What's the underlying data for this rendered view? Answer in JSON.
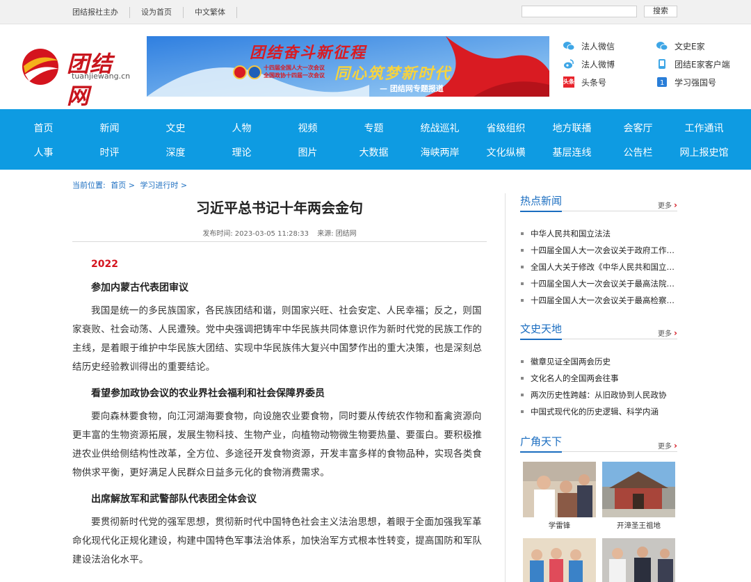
{
  "topbar": {
    "links": [
      "团结报社主办",
      "设为首页",
      "中文繁体"
    ],
    "search_placeholder": "",
    "search_button": "搜索"
  },
  "header": {
    "logo_text": "团结网",
    "logo_domain": "tuanjiewang.cn",
    "banner": {
      "title": "团结奋斗新征程",
      "subtitle": "同心筑梦新时代",
      "line1": "十四届全国人大一次会议",
      "line2": "全国政协十四届一次会议",
      "tag": "— 团结网专题报道"
    },
    "social_left": [
      "法人微信",
      "法人微博",
      "头条号"
    ],
    "social_right": [
      "文史E家",
      "团结E家客户端",
      "学习强国号"
    ],
    "toutiao_badge": "头条"
  },
  "nav": {
    "row1": [
      "首页",
      "新闻",
      "文史",
      "人物",
      "视频",
      "专题",
      "统战巡礼",
      "省级组织",
      "地方联播",
      "会客厅",
      "工作通讯"
    ],
    "row2": [
      "人事",
      "时评",
      "深度",
      "理论",
      "图片",
      "大数据",
      "海峡两岸",
      "文化纵横",
      "基层连线",
      "公告栏",
      "网上报史馆"
    ]
  },
  "breadcrumb": {
    "label": "当前位置:",
    "items": [
      "首页 >",
      "学习进行时 >"
    ]
  },
  "article": {
    "title": "习近平总书记十年两会金句",
    "meta_time_label": "发布时间:",
    "meta_time": "2023-03-05 11:28:33",
    "meta_source_label": "来源:",
    "meta_source": "团结网",
    "year": "2022",
    "sections": [
      {
        "heading": "参加内蒙古代表团审议",
        "body": "我国是统一的多民族国家，各民族团结和谐，则国家兴旺、社会安定、人民幸福；反之，则国家衰败、社会动荡、人民遭殃。党中央强调把铸牢中华民族共同体意识作为新时代党的民族工作的主线，是着眼于维护中华民族大团结、实现中华民族伟大复兴中国梦作出的重大决策，也是深刻总结历史经验教训得出的重要结论。"
      },
      {
        "heading": "看望参加政协会议的农业界社会福利和社会保障界委员",
        "body": "要向森林要食物，向江河湖海要食物，向设施农业要食物，同时要从传统农作物和畜禽资源向更丰富的生物资源拓展，发展生物科技、生物产业，向植物动物微生物要热量、要蛋白。要积极推进农业供给侧结构性改革，全方位、多途径开发食物资源，开发丰富多样的食物品种，实现各类食物供求平衡，更好满足人民群众日益多元化的食物消费需求。"
      },
      {
        "heading": "出席解放军和武警部队代表团全体会议",
        "body": "要贯彻新时代党的强军思想，贯彻新时代中国特色社会主义法治思想，着眼于全面加强我军革命化现代化正规化建设，构建中国特色军事法治体系，加快治军方式根本性转变，提高国防和军队建设法治化水平。"
      }
    ]
  },
  "sidebar": {
    "more_label": "更多",
    "hot_news": {
      "title": "热点新闻",
      "items": [
        "中华人民共和国立法法",
        "十四届全国人大一次会议关于政府工作报告的决议",
        "全国人大关于修改《中华人民共和国立法法》的决定",
        "十四届全国人大一次会议关于最高法院工作报告的决议",
        "十四届全国人大一次会议关于最高检察院工作报告的决议"
      ]
    },
    "wenshi": {
      "title": "文史天地",
      "items": [
        "徽章见证全国两会历史",
        "文化名人的全国两会往事",
        "两次历史性跨越：从旧政协到人民政协",
        "中国式现代化的历史逻辑、科学内涵"
      ]
    },
    "guangjiao": {
      "title": "广角天下",
      "captions": [
        "学雷锋",
        "开漳圣王祖地"
      ]
    }
  },
  "colors": {
    "nav_bg": "#0e9be2",
    "accent_red": "#d4141e",
    "link_blue": "#1a6dc0"
  }
}
